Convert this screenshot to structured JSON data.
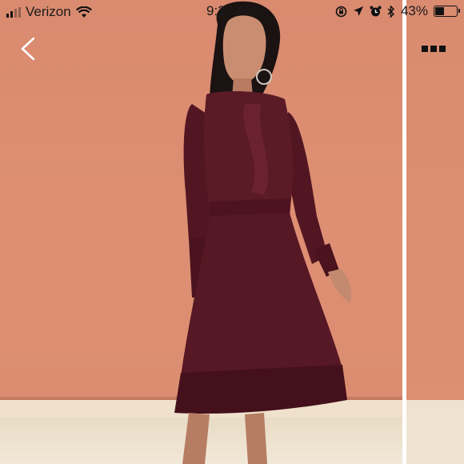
{
  "status_bar": {
    "carrier": "Verizon",
    "time": "9:37 AM",
    "battery_percent": "43%",
    "battery_level": 0.43,
    "signal_bars": 2,
    "icons": [
      "signal-icon",
      "wifi-icon",
      "screen-lock-icon",
      "location-icon",
      "alarm-icon",
      "bluetooth-icon",
      "battery-icon"
    ]
  },
  "nav": {
    "back_icon": "chevron-left-icon",
    "more_icon": "more-dots-icon"
  },
  "photo": {
    "subject": "model-in-burgundy-dress-photo"
  },
  "colors": {
    "dress": "#5a1a26",
    "wall": "#dd8f73",
    "floor": "#efe1cc"
  }
}
